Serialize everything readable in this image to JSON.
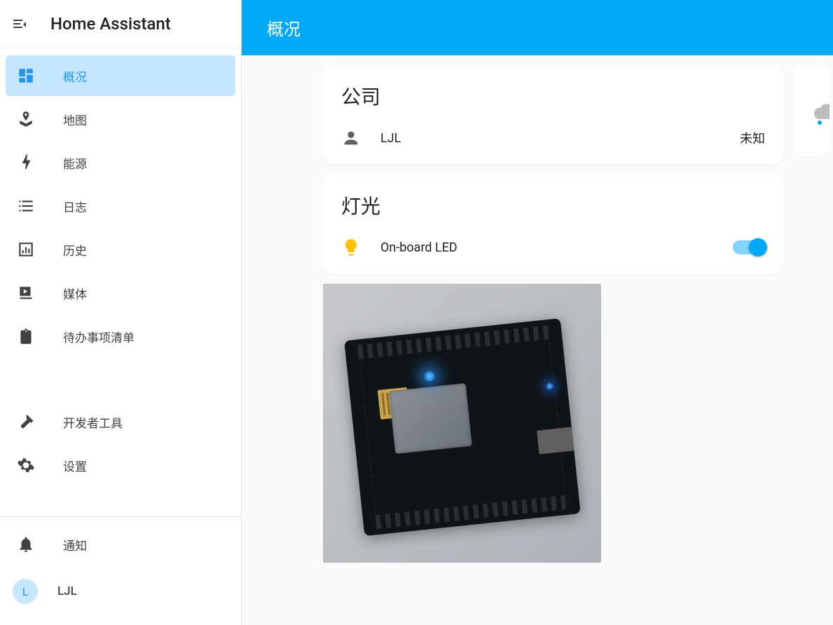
{
  "app": {
    "title": "Home Assistant",
    "topbar_title": "概况"
  },
  "sidebar": {
    "items": [
      {
        "label": "概况"
      },
      {
        "label": "地图"
      },
      {
        "label": "能源"
      },
      {
        "label": "日志"
      },
      {
        "label": "历史"
      },
      {
        "label": "媒体"
      },
      {
        "label": "待办事项清单"
      }
    ],
    "bottom": [
      {
        "label": "开发者工具"
      },
      {
        "label": "设置"
      }
    ],
    "footer": {
      "notifications_label": "通知",
      "user_initial": "L",
      "user_name": "LJL"
    }
  },
  "cards": {
    "presence": {
      "title": "公司",
      "rows": [
        {
          "name": "LJL",
          "value": "未知"
        }
      ]
    },
    "lights": {
      "title": "灯光",
      "rows": [
        {
          "name": "On-board LED",
          "on": true
        }
      ]
    }
  }
}
